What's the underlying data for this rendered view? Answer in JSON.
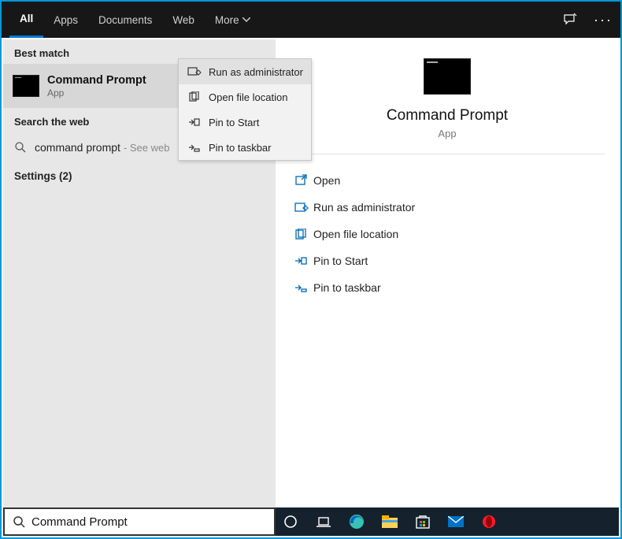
{
  "tabs": {
    "all": "All",
    "apps": "Apps",
    "documents": "Documents",
    "web": "Web",
    "more": "More"
  },
  "left": {
    "best_match": "Best match",
    "result_title": "Command Prompt",
    "result_sub": "App",
    "search_web": "Search the web",
    "web_query": "command prompt",
    "web_hint": "- See web",
    "settings": "Settings (2)"
  },
  "context_menu": {
    "run_admin": "Run as administrator",
    "open_loc": "Open file location",
    "pin_start": "Pin to Start",
    "pin_taskbar": "Pin to taskbar"
  },
  "detail": {
    "title": "Command Prompt",
    "sub": "App",
    "open": "Open",
    "run_admin": "Run as administrator",
    "open_loc": "Open file location",
    "pin_start": "Pin to Start",
    "pin_taskbar": "Pin to taskbar"
  },
  "search": {
    "value": "Command Prompt"
  }
}
